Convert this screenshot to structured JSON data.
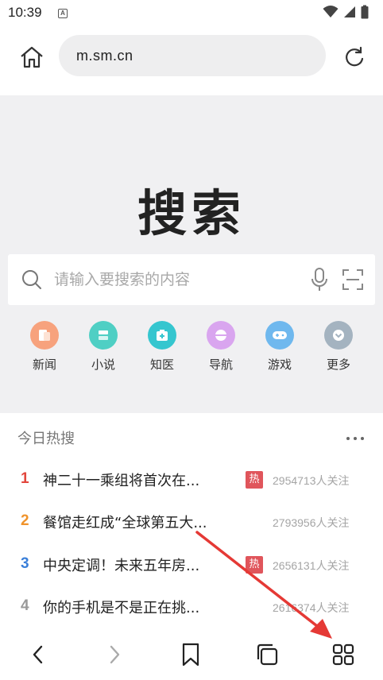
{
  "status_bar": {
    "time": "10:39",
    "notification_icon": "a-icon",
    "wifi_icon": "wifi-icon",
    "signal_icon": "signal-icon",
    "battery_icon": "battery-icon"
  },
  "address_bar": {
    "url": "m.sm.cn",
    "home_icon": "home-icon",
    "refresh_icon": "refresh-icon"
  },
  "hero": {
    "logo": "搜索",
    "search": {
      "placeholder": "请输入要搜索的内容",
      "search_icon": "search-icon",
      "mic_icon": "mic-icon",
      "scan_icon": "scan-icon"
    },
    "shortcuts": [
      {
        "label": "新闻",
        "icon": "news-icon",
        "color": "#f7a27d"
      },
      {
        "label": "小说",
        "icon": "novel-icon",
        "color": "#4fcfc4"
      },
      {
        "label": "知医",
        "icon": "medical-icon",
        "color": "#35c6cf"
      },
      {
        "label": "导航",
        "icon": "navigation-icon",
        "color": "#d9a5ef"
      },
      {
        "label": "游戏",
        "icon": "game-icon",
        "color": "#6fb8ee"
      },
      {
        "label": "更多",
        "icon": "more-icon",
        "color": "#a4b3c0"
      }
    ]
  },
  "hot_search": {
    "title": "今日热搜",
    "more_icon": "more-dots-icon",
    "items": [
      {
        "rank": "1",
        "text": "神二十一乘组将首次在...",
        "badge": "热",
        "count": "2954713人关注",
        "rank_color": "#e2463c"
      },
      {
        "rank": "2",
        "text": "餐馆走红成“全球第五大...",
        "badge": "",
        "count": "2793956人关注",
        "rank_color": "#f0932b"
      },
      {
        "rank": "3",
        "text": "中央定调！未来五年房...",
        "badge": "热",
        "count": "2656131人关注",
        "rank_color": "#3a7fd9"
      },
      {
        "rank": "4",
        "text": "你的手机是不是正在挑...",
        "badge": "",
        "count": "2616374人关注",
        "rank_color": "#999999"
      }
    ]
  },
  "bottom_nav": {
    "back_icon": "chevron-left-icon",
    "forward_icon": "chevron-right-icon",
    "bookmark_icon": "bookmark-icon",
    "tabs_icon": "tabs-icon",
    "menu_icon": "grid-menu-icon"
  },
  "colors": {
    "annotation_arrow": "#e53935",
    "hero_background": "#f0f0f2",
    "hot_badge": "#e0555b"
  }
}
